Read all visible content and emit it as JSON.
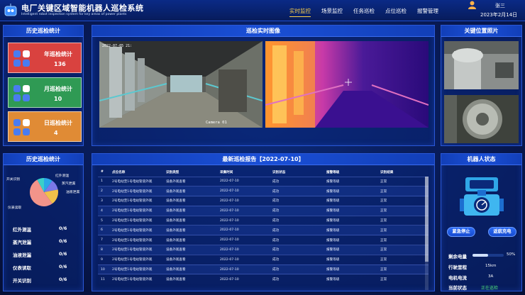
{
  "app": {
    "title": "电厂关键区域智能机器人巡检系统",
    "subtitle": "Intelligent robot inspection system for key areas of power plants",
    "user": "张三",
    "date": "2023年2月14日"
  },
  "nav": [
    "实时监控",
    "场景监控",
    "任务巡检",
    "点位巡检",
    "报警管理"
  ],
  "history_panel": {
    "title": "历史巡检统计",
    "cards": [
      {
        "label": "年巡检统计",
        "value": "136",
        "color": "#d9423f"
      },
      {
        "label": "月巡检统计",
        "value": "10",
        "color": "#2f9a54"
      },
      {
        "label": "日巡检统计",
        "value": "4",
        "color": "#e08b35"
      }
    ]
  },
  "camera_panel": {
    "title": "巡检实时图像",
    "cam_label": "Camera 01",
    "cam_time": "2022-07-05 21:"
  },
  "key_photos": {
    "title": "关键位置照片"
  },
  "stats_panel": {
    "title": "历史巡检统计",
    "pie_labels": [
      "开关识别",
      "红外测温",
      "蒸汽泄漏",
      "油液泄漏",
      "仪表读取"
    ],
    "list": [
      {
        "label": "红外测温",
        "value": "0/6"
      },
      {
        "label": "蒸汽泄漏",
        "value": "0/6"
      },
      {
        "label": "油液泄漏",
        "value": "0/6"
      },
      {
        "label": "仪表读取",
        "value": "0/6"
      },
      {
        "label": "开关识别",
        "value": "0/6"
      }
    ]
  },
  "chart_data": {
    "type": "pie",
    "categories": [
      "开关识别",
      "红外测温",
      "蒸汽泄漏",
      "油液泄漏",
      "仪表读取"
    ],
    "values": [
      8,
      10,
      12,
      18,
      52
    ],
    "colors": [
      "#3ad0c8",
      "#2aa7e8",
      "#7a78e8",
      "#f0c14a",
      "#f2948a"
    ]
  },
  "report": {
    "title": "最新巡检报告【2022-07-10】",
    "columns": [
      "#",
      "点位名称",
      "识别类型",
      "采集时间",
      "识别状态",
      "报警等级",
      "识别结果"
    ],
    "rows": [
      [
        "1",
        "2号电站至1号电站管道外观",
        "设备外观查看",
        "2022-07-10",
        "成功",
        "报警等级",
        "正常"
      ],
      [
        "2",
        "2号电站至1号电站管道外观",
        "设备外观查看",
        "2022-07-10",
        "成功",
        "报警等级",
        "正常"
      ],
      [
        "3",
        "2号电站至1号电站管道外观",
        "设备外观查看",
        "2022-07-10",
        "成功",
        "报警等级",
        "正常"
      ],
      [
        "4",
        "2号电站至1号电站管道外观",
        "设备外观查看",
        "2022-07-10",
        "成功",
        "报警等级",
        "正常"
      ],
      [
        "5",
        "2号电站至1号电站管道外观",
        "设备外观查看",
        "2022-07-10",
        "成功",
        "报警等级",
        "正常"
      ],
      [
        "6",
        "2号电站至1号电站管道外观",
        "设备外观查看",
        "2022-07-10",
        "成功",
        "报警等级",
        "正常"
      ],
      [
        "7",
        "2号电站至1号电站管道外观",
        "设备外观查看",
        "2022-07-10",
        "成功",
        "报警等级",
        "正常"
      ],
      [
        "8",
        "2号电站至1号电站管道外观",
        "设备外观查看",
        "2022-07-10",
        "成功",
        "报警等级",
        "正常"
      ],
      [
        "9",
        "2号电站至1号电站管道外观",
        "设备外观查看",
        "2022-07-10",
        "成功",
        "报警等级",
        "正常"
      ],
      [
        "10",
        "2号电站至1号电站管道外观",
        "设备外观查看",
        "2022-07-10",
        "成功",
        "报警等级",
        "正常"
      ],
      [
        "11",
        "2号电站至1号电站管道外观",
        "设备外观查看",
        "2022-07-10",
        "成功",
        "报警等级",
        "正常"
      ]
    ]
  },
  "robot": {
    "title": "机器人状态",
    "stop_btn": "紧急停止",
    "charge_btn": "返航充电",
    "status": [
      {
        "label": "剩余电量",
        "value": "50%"
      },
      {
        "label": "行驶里程",
        "value": "15km"
      },
      {
        "label": "电机电流",
        "value": "3A"
      },
      {
        "label": "当前状态",
        "value": "正在巡检"
      }
    ],
    "battery_level": 0.5
  }
}
